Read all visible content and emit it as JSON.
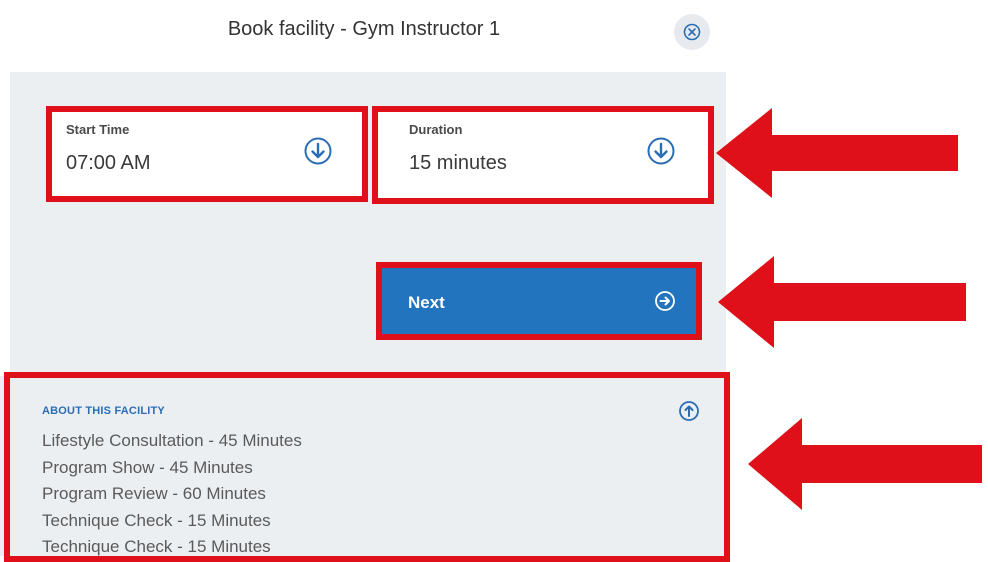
{
  "dialog": {
    "title": "Book facility - Gym Instructor 1",
    "close_icon": "close-circle-icon"
  },
  "form": {
    "start_time": {
      "label": "Start Time",
      "value": "07:00 AM",
      "icon": "arrow-down-circle-icon"
    },
    "duration": {
      "label": "Duration",
      "value": "15 minutes",
      "icon": "arrow-down-circle-icon"
    },
    "next_button": {
      "label": "Next",
      "icon": "arrow-right-circle-icon"
    }
  },
  "about": {
    "heading": "ABOUT THIS FACILITY",
    "toggle_icon": "arrow-up-circle-icon",
    "items": [
      "Lifestyle Consultation - 45 Minutes",
      "Program Show - 45 Minutes",
      "Program Review - 60 Minutes",
      "Technique Check - 15 Minutes",
      "Technique Check - 15 Minutes"
    ]
  },
  "colors": {
    "accent": "#2374be",
    "panel": "#eceff2",
    "highlight": "#e0101a"
  }
}
